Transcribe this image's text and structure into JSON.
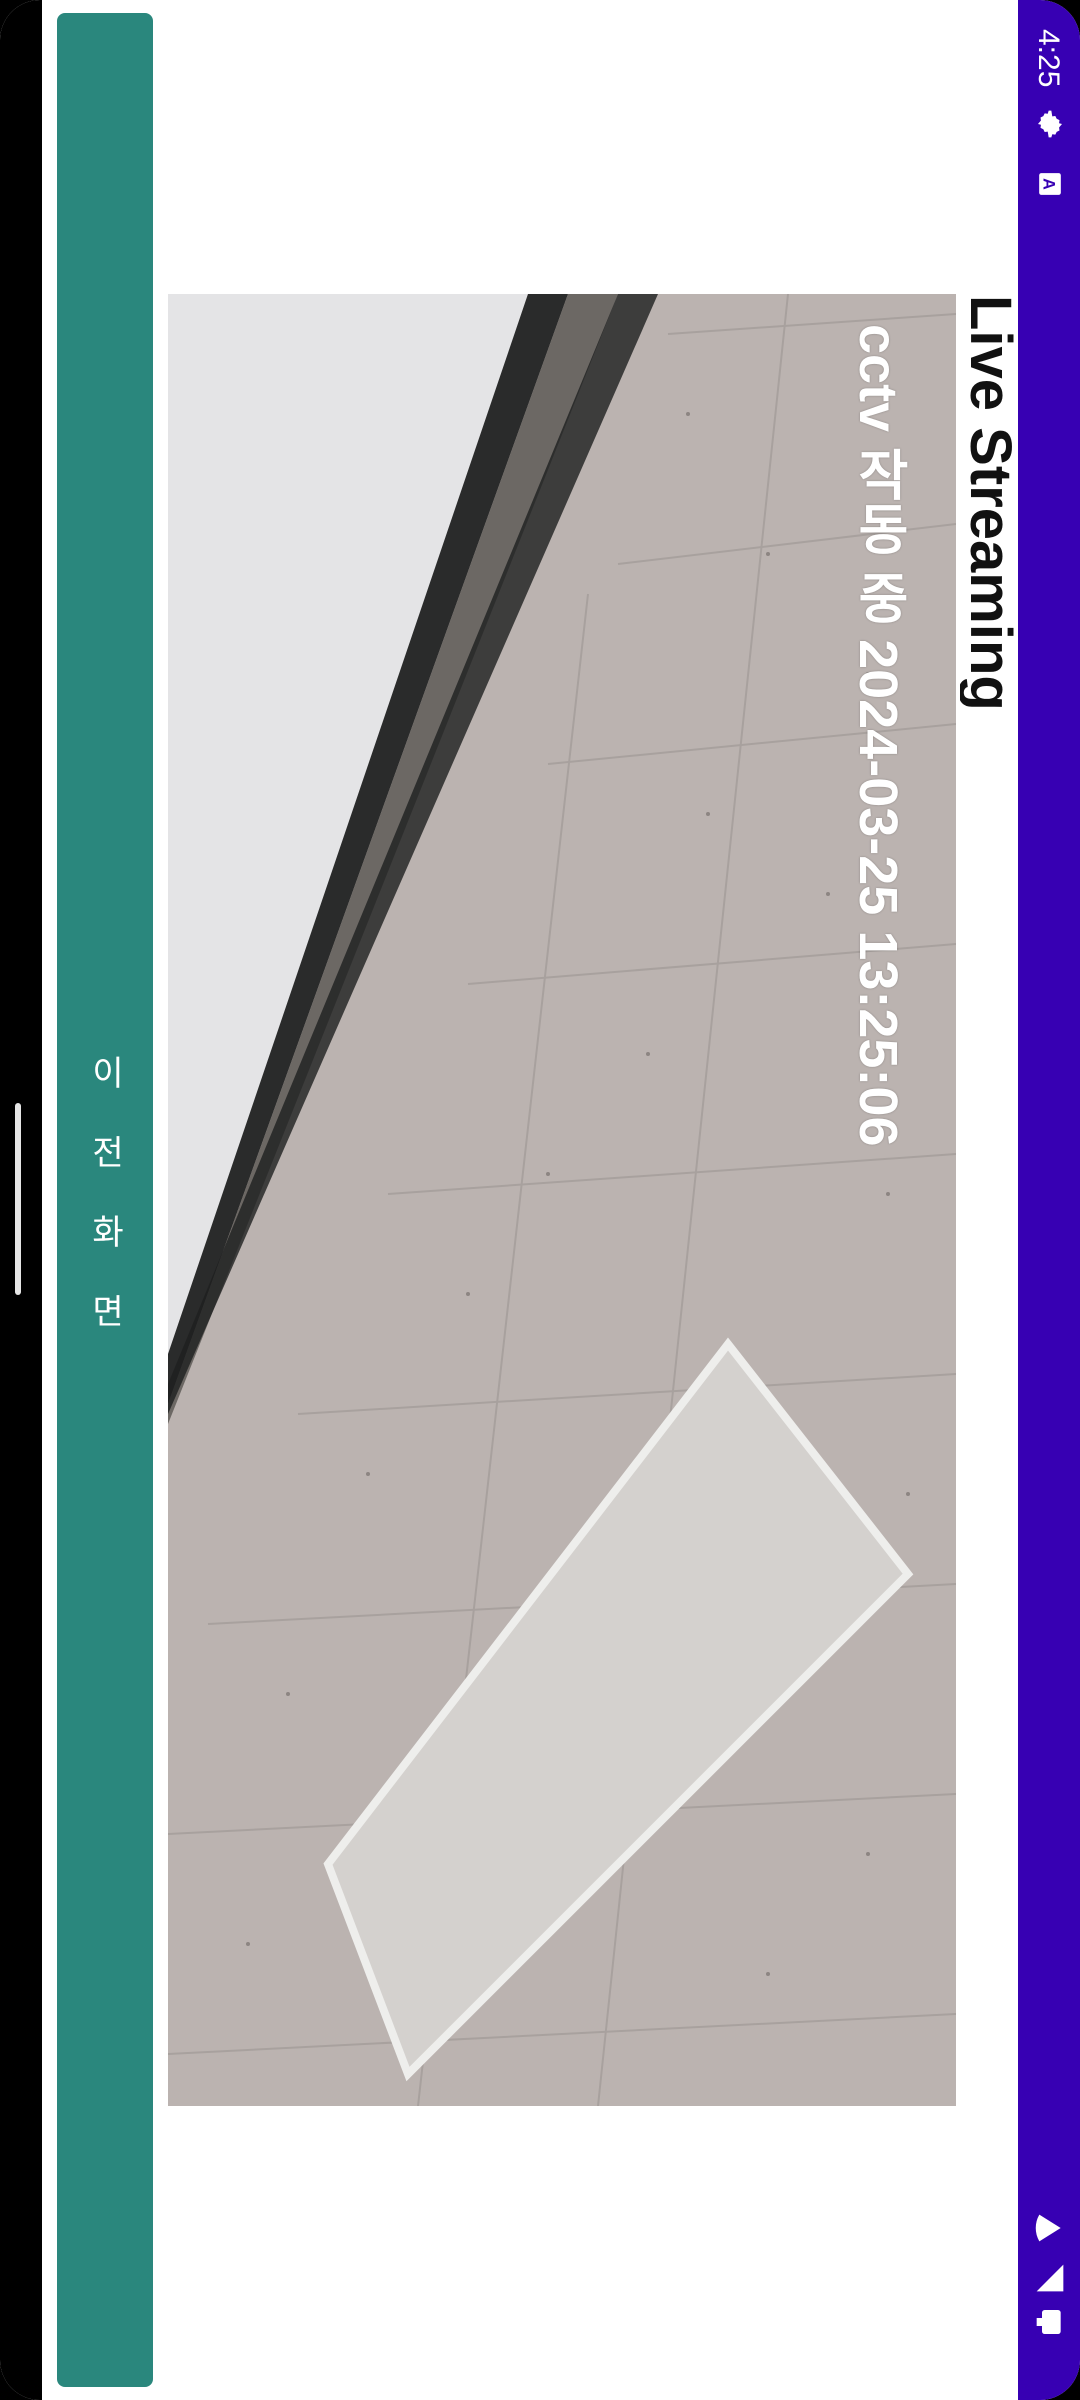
{
  "status_bar": {
    "time": "4:25",
    "icons": [
      "settings-icon",
      "accessibility-icon",
      "wifi-icon",
      "signal-icon",
      "battery-icon"
    ],
    "background": "#3700B3"
  },
  "page": {
    "title": "Live Streaming"
  },
  "video": {
    "overlay": "cctv 작동 중 2024-03-25 13:25:06"
  },
  "back_button": {
    "label": "이 전 화 면",
    "color": "#2a877d"
  }
}
